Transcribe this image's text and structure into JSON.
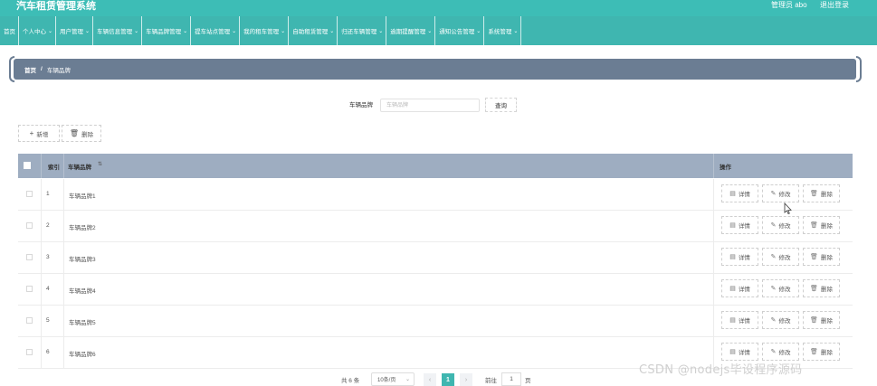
{
  "header": {
    "app_title": "汽车租赁管理系统",
    "admin_label": "管理员 abo",
    "logout_label": "退出登录"
  },
  "nav": {
    "items": [
      {
        "label": "首页",
        "has_dropdown": false
      },
      {
        "label": "个人中心",
        "has_dropdown": true
      },
      {
        "label": "用户管理",
        "has_dropdown": true
      },
      {
        "label": "车辆信息管理",
        "has_dropdown": true
      },
      {
        "label": "车辆品牌管理",
        "has_dropdown": true
      },
      {
        "label": "提车站点管理",
        "has_dropdown": true
      },
      {
        "label": "我的租车管理",
        "has_dropdown": true
      },
      {
        "label": "自助租赁管理",
        "has_dropdown": true
      },
      {
        "label": "归还车辆管理",
        "has_dropdown": true
      },
      {
        "label": "逾期提醒管理",
        "has_dropdown": true
      },
      {
        "label": "通知公告管理",
        "has_dropdown": true
      },
      {
        "label": "系统管理",
        "has_dropdown": true
      }
    ],
    "chevron_icon": "chevron-down-icon"
  },
  "breadcrumb": {
    "home": "首页",
    "separator": "/",
    "current": "车辆品牌"
  },
  "search": {
    "label": "车辆品牌",
    "placeholder": "车辆品牌",
    "button_label": "查询"
  },
  "toolbar": {
    "add_label": "新增",
    "delete_label": "删除"
  },
  "table": {
    "columns": {
      "index": "索引",
      "brand": "车辆品牌",
      "actions": "操作"
    },
    "rows": [
      {
        "index": "1",
        "brand": "车辆品牌1"
      },
      {
        "index": "2",
        "brand": "车辆品牌2"
      },
      {
        "index": "3",
        "brand": "车辆品牌3"
      },
      {
        "index": "4",
        "brand": "车辆品牌4"
      },
      {
        "index": "5",
        "brand": "车辆品牌5"
      },
      {
        "index": "6",
        "brand": "车辆品牌6"
      }
    ],
    "row_actions": {
      "detail": "详情",
      "edit": "修改",
      "delete": "删除"
    }
  },
  "pagination": {
    "total_text": "共 6 条",
    "page_size": "10条/页",
    "current_page": "1",
    "goto_label": "前往",
    "goto_value": "1",
    "page_unit": "页"
  },
  "watermark": "CSDN @nodejs毕设程序源码",
  "colors": {
    "header_teal": "#3dbdb6",
    "nav_teal": "#3fb6b0",
    "breadcrumb_slate": "#6b7d93",
    "table_header": "#9eadc1"
  }
}
